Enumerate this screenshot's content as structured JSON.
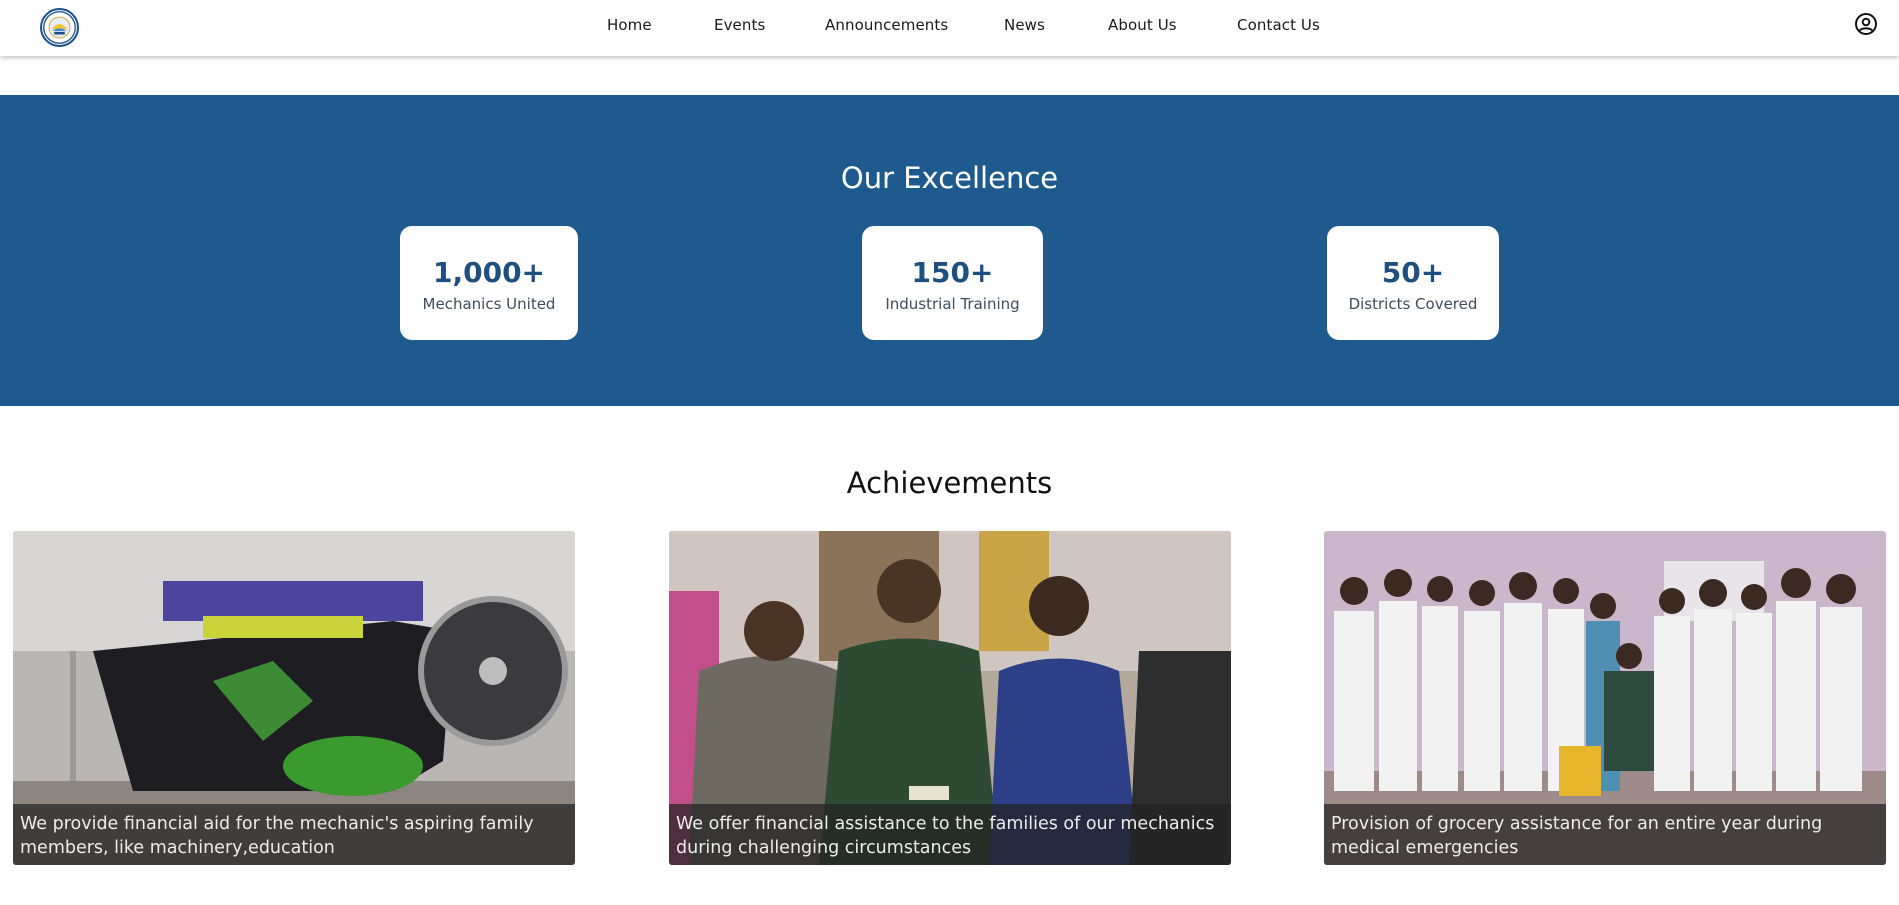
{
  "nav": {
    "logo_icon": "organization-logo-icon",
    "links": [
      "Home",
      "Events",
      "Announcements",
      "News",
      "About Us",
      "Contact Us"
    ],
    "profile_icon": "user-profile-icon"
  },
  "excellence": {
    "title": "Our Excellence",
    "background": "#1f5a8f",
    "stats": [
      {
        "value": "1,000+",
        "label": "Mechanics United"
      },
      {
        "value": "150+",
        "label": "Industrial Training"
      },
      {
        "value": "50+",
        "label": "Districts Covered"
      }
    ]
  },
  "achievements": {
    "title": "Achievements",
    "cards": [
      {
        "caption": "We provide financial aid for the mechanic's aspiring family members, like machinery,education",
        "image": "sewing-machine-photo"
      },
      {
        "caption": "We offer financial assistance to the families of our mechanics during challenging circumstances",
        "image": "group-handover-photo"
      },
      {
        "caption": "Provision of grocery assistance for an entire year during medical emergencies",
        "image": "group-photo"
      }
    ]
  }
}
